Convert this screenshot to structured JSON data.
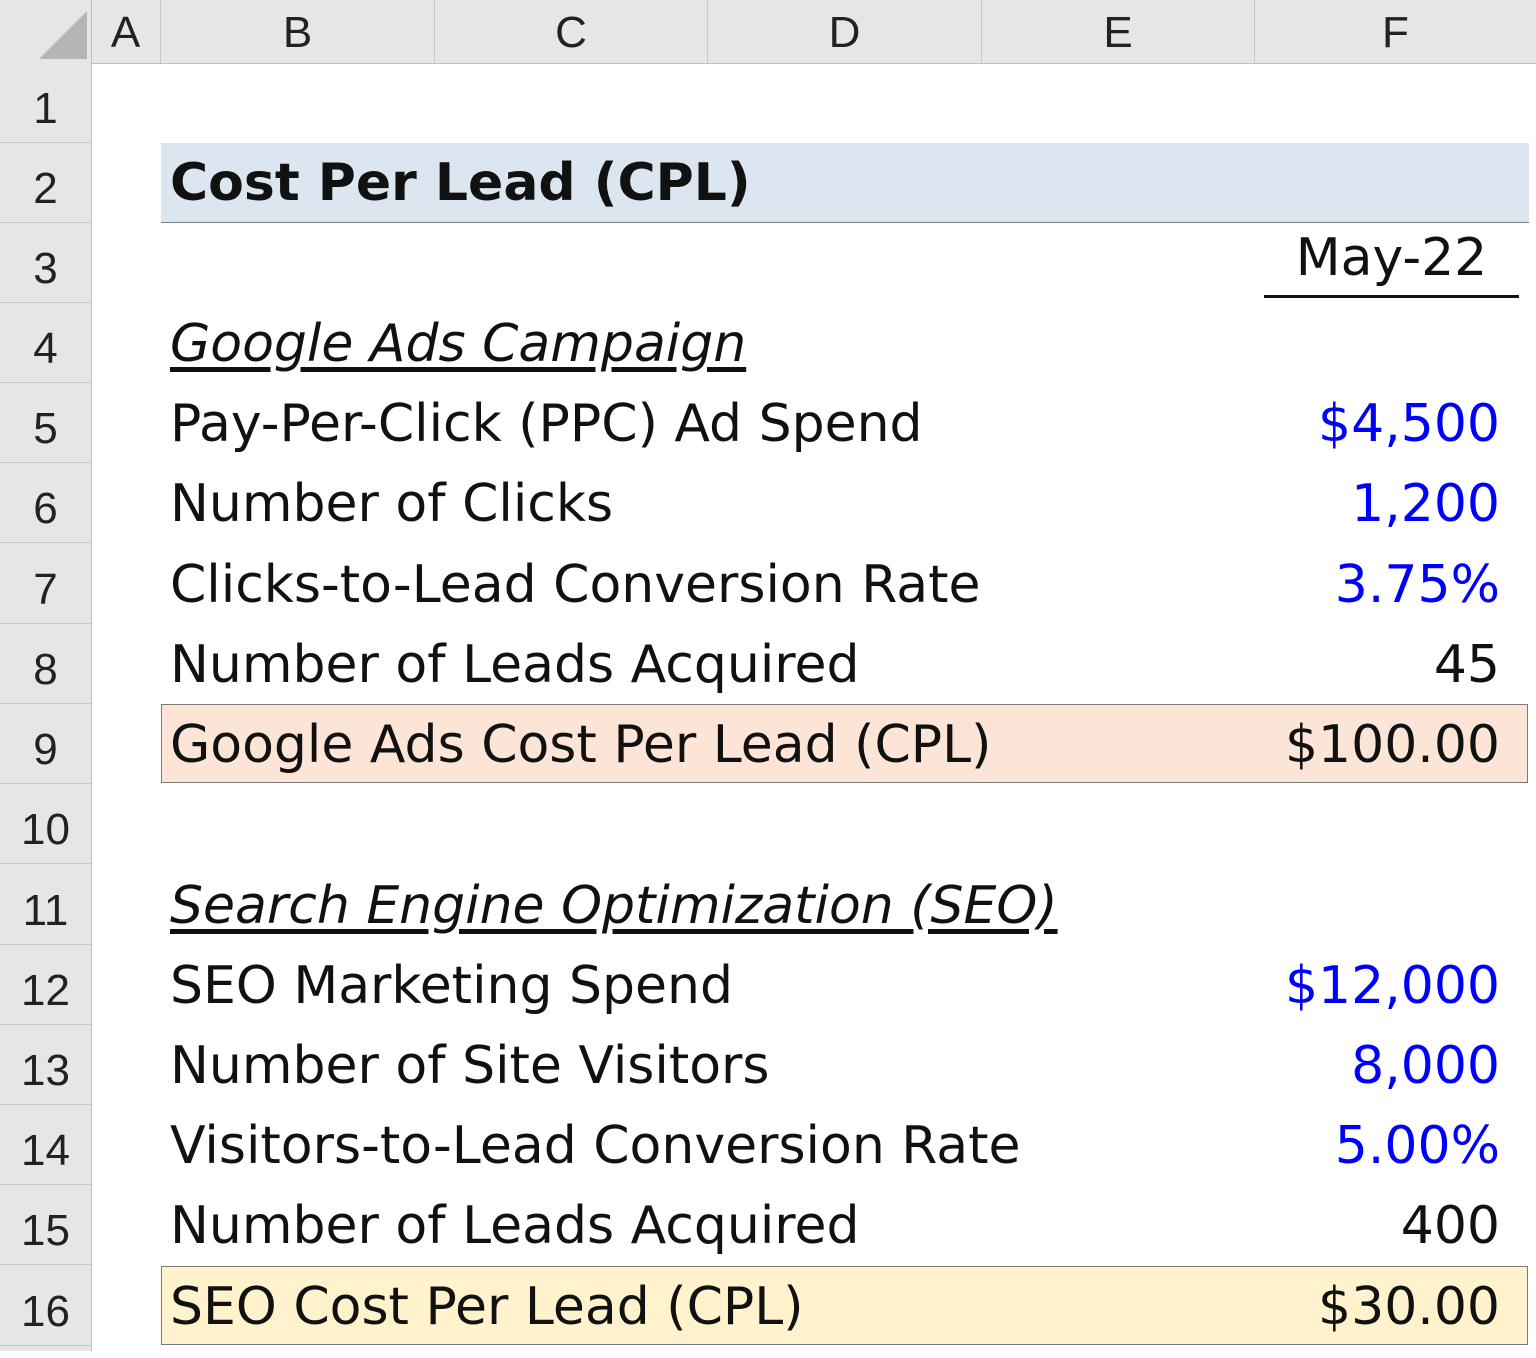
{
  "columns": [
    "A",
    "B",
    "C",
    "D",
    "E",
    "F"
  ],
  "rows": [
    "1",
    "2",
    "3",
    "4",
    "5",
    "6",
    "7",
    "8",
    "9",
    "10",
    "11",
    "12",
    "13",
    "14",
    "15",
    "16"
  ],
  "title": "Cost Per Lead (CPL)",
  "period": "May-22",
  "google_ads": {
    "heading": "Google Ads Campaign",
    "ad_spend_label": "Pay-Per-Click (PPC) Ad Spend",
    "ad_spend_value": "$4,500",
    "clicks_label": "Number of Clicks",
    "clicks_value": "1,200",
    "conversion_label": "Clicks-to-Lead Conversion Rate",
    "conversion_value": "3.75%",
    "leads_label": "Number of Leads Acquired",
    "leads_value": "45",
    "cpl_label": "Google Ads Cost Per Lead (CPL)",
    "cpl_value": "$100.00"
  },
  "seo": {
    "heading": "Search Engine Optimization (SEO)",
    "spend_label": "SEO Marketing Spend",
    "spend_value": "$12,000",
    "visitors_label": "Number of Site Visitors",
    "visitors_value": "8,000",
    "conversion_label": "Visitors-to-Lead Conversion Rate",
    "conversion_value": "5.00%",
    "leads_label": "Number of Leads Acquired",
    "leads_value": "400",
    "cpl_label": "SEO Cost Per Lead (CPL)",
    "cpl_value": "$30.00"
  },
  "colors": {
    "input_blue": "#0000ff",
    "title_band": "#dce6f1",
    "google_cpl_fill": "#fce4d6",
    "seo_cpl_fill": "#fff2cc"
  }
}
